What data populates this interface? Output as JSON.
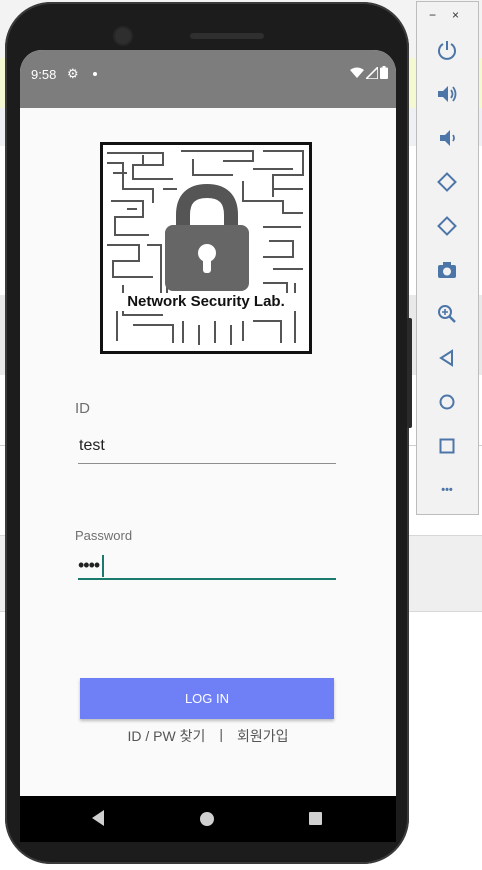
{
  "status_bar": {
    "time": "9:58"
  },
  "logo": {
    "text": "Network Security Lab."
  },
  "form": {
    "id_label": "ID",
    "id_value": "test",
    "password_label": "Password",
    "password_value": "••••"
  },
  "actions": {
    "login_label": "LOG IN",
    "find_label": "ID / PW 찾기",
    "separator": "|",
    "signup_label": "회원가입"
  },
  "emulator_toolbar": {
    "minimize": "−",
    "close": "×",
    "more": "•••",
    "buttons": [
      "power-icon",
      "volume-up-icon",
      "volume-down-icon",
      "rotate-left-icon",
      "rotate-right-icon",
      "camera-icon",
      "zoom-icon",
      "back-icon",
      "home-icon",
      "overview-icon",
      "more-icon"
    ]
  },
  "colors": {
    "accent_button": "#6f7ff5",
    "focus_underline": "#1a7a6d",
    "status_bar": "#7d7d7d"
  }
}
